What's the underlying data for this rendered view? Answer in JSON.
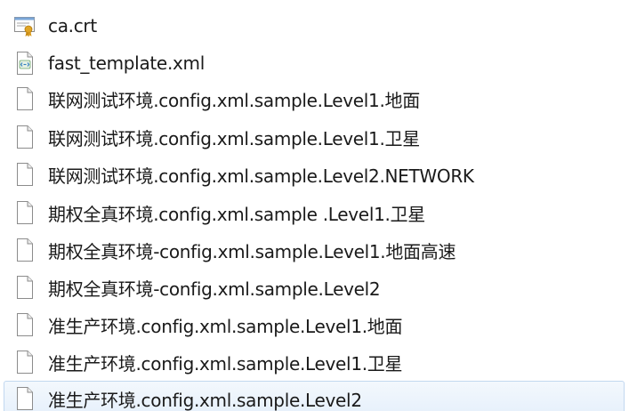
{
  "files": [
    {
      "name": "ca.crt",
      "icon": "certificate-icon"
    },
    {
      "name": "fast_template.xml",
      "icon": "xml-file-icon"
    },
    {
      "name": "联网测试环境.config.xml.sample.Level1.地面",
      "icon": "blank-file-icon"
    },
    {
      "name": "联网测试环境.config.xml.sample.Level1.卫星",
      "icon": "blank-file-icon"
    },
    {
      "name": "联网测试环境.config.xml.sample.Level2.NETWORK",
      "icon": "blank-file-icon"
    },
    {
      "name": "期权全真环境.config.xml.sample .Level1.卫星",
      "icon": "blank-file-icon"
    },
    {
      "name": "期权全真环境-config.xml.sample.Level1.地面高速",
      "icon": "blank-file-icon"
    },
    {
      "name": "期权全真环境-config.xml.sample.Level2",
      "icon": "blank-file-icon"
    },
    {
      "name": "准生产环境.config.xml.sample.Level1.地面",
      "icon": "blank-file-icon"
    },
    {
      "name": "准生产环境.config.xml.sample.Level1.卫星",
      "icon": "blank-file-icon"
    },
    {
      "name": "准生产环境.config.xml.sample.Level2",
      "icon": "blank-file-icon"
    }
  ],
  "selected_index": 10,
  "colors": {
    "selection_bg": "#e6f0fb",
    "selection_border": "#c2d8f0",
    "text": "#1a1a1a",
    "certificate_ribbon": "#e0a526"
  }
}
